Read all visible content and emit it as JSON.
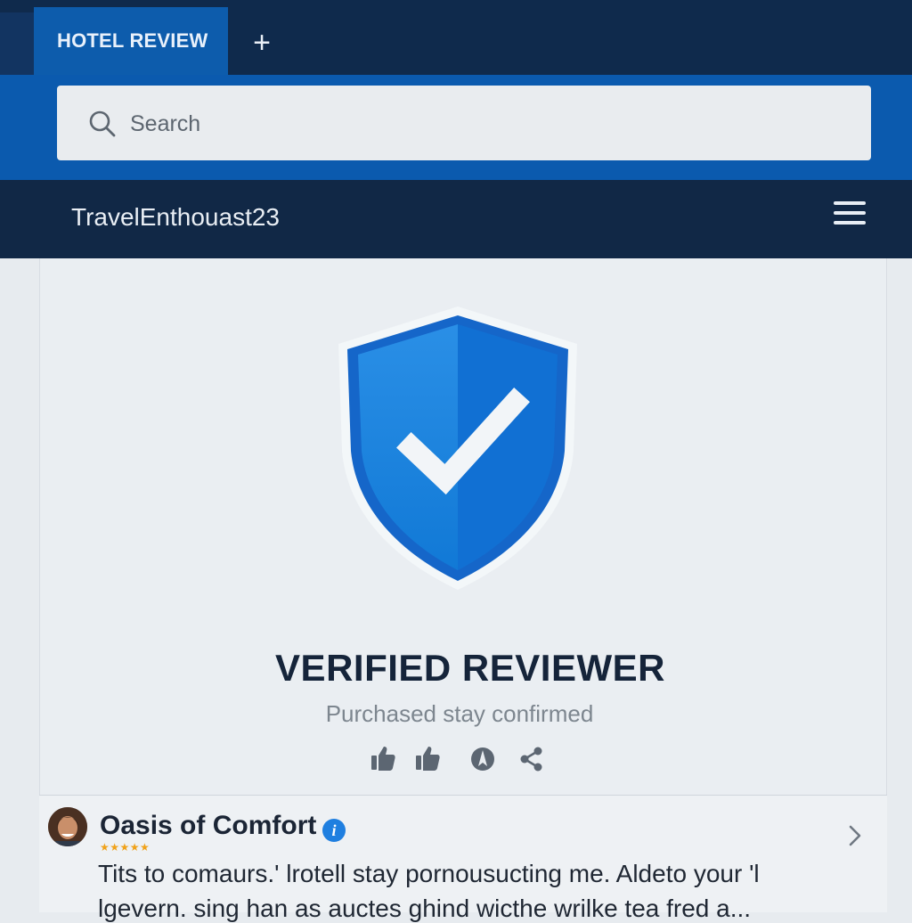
{
  "tabs": [
    {
      "label": "HOTEL REVIEW"
    }
  ],
  "new_tab_label": "+",
  "search": {
    "placeholder": "Search",
    "value": ""
  },
  "user": {
    "name": "TravelEnthouast23"
  },
  "verification": {
    "title": "VERIFIED REVIEWER",
    "subtitle": "Purchased stay confirmed"
  },
  "icons": {
    "tab_add": "plus-icon",
    "search": "search-icon",
    "menu": "hamburger-menu-icon",
    "shield": "shield-check-icon",
    "actions": [
      "thumbs-up-icon",
      "thumbs-up-icon",
      "compass-icon",
      "share-icon"
    ],
    "info": "info-icon",
    "chevron": "chevron-right-icon"
  },
  "review": {
    "hotel": "Oasis of Comfort",
    "info_glyph": "i",
    "stars": "★★★★★",
    "rating": 5,
    "text_line1": "Tits to comaurs.' lrotell stay pornousucting me. Aldeto your 'l",
    "text_line2": "lgevern. sing han as auctes ghind wicthe wrilke tea fred a..."
  },
  "colors": {
    "header_dark": "#0f2a4c",
    "tab_active": "#0d5cac",
    "search_band": "#0b5aae",
    "user_bar": "#112846",
    "shield_light": "#1a86e0",
    "shield_dark": "#0d6bc6",
    "star": "#f0a21a"
  }
}
